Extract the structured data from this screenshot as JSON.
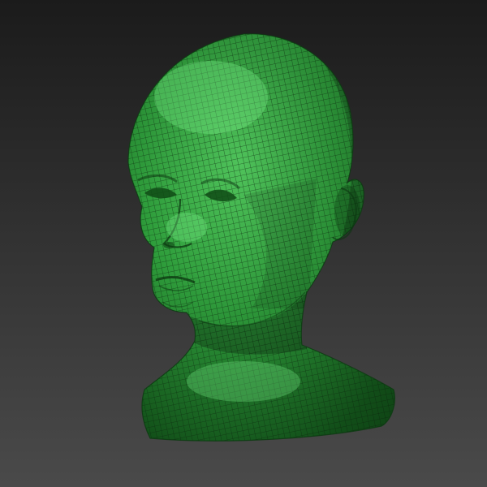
{
  "scene": {
    "subject": "head-bust-wireframe",
    "colors": {
      "background_top": "#1b1b1b",
      "background_bottom": "#4a4a4a",
      "mesh_base": "#2f9f3c",
      "mesh_highlight": "#55d061",
      "mesh_shadow": "#145a1c",
      "wire_line": "#0d2c10"
    }
  }
}
